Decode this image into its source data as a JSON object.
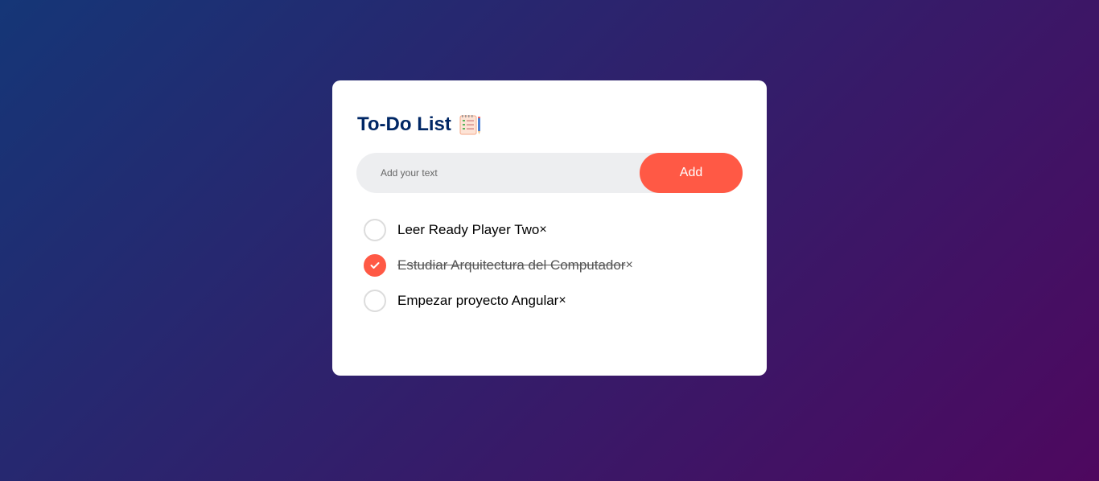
{
  "app": {
    "title": "To-Do List"
  },
  "input": {
    "placeholder": "Add your text",
    "value": ""
  },
  "add_button": {
    "label": "Add"
  },
  "tasks": [
    {
      "text": "Leer Ready Player Two",
      "done": false,
      "remove_label": "×"
    },
    {
      "text": "Estudiar Arquitectura del Computador",
      "done": true,
      "remove_label": "×"
    },
    {
      "text": "Empezar proyecto Angular",
      "done": false,
      "remove_label": "×"
    }
  ],
  "icons": {
    "title": "checklist-notebook-icon",
    "checked": "checkmark-icon"
  },
  "colors": {
    "accent": "#ff5945",
    "title": "#002765",
    "gradient_start": "#153677",
    "gradient_end": "#4e085f",
    "input_bg": "#edeef0"
  }
}
